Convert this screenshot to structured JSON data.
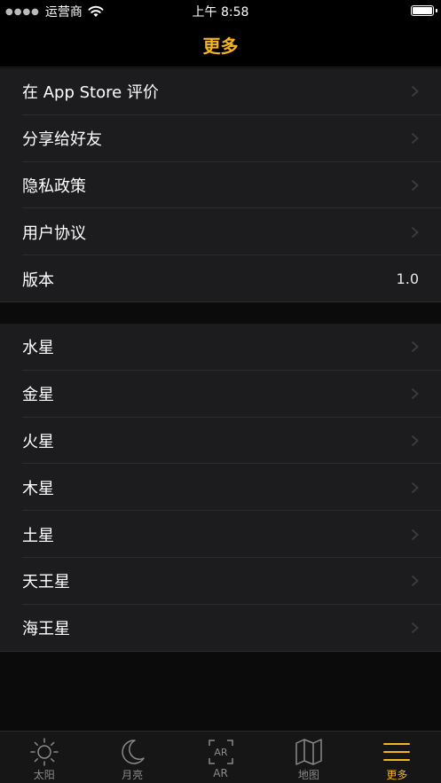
{
  "status_bar": {
    "carrier": "运营商",
    "time": "上午 8:58"
  },
  "nav": {
    "title": "更多"
  },
  "section_1": [
    {
      "label": "在 App Store 评价",
      "has_chevron": true
    },
    {
      "label": "分享给好友",
      "has_chevron": true
    },
    {
      "label": "隐私政策",
      "has_chevron": true
    },
    {
      "label": "用户协议",
      "has_chevron": true
    },
    {
      "label": "版本",
      "value": "1.0",
      "has_chevron": false
    }
  ],
  "section_2": [
    {
      "label": "水星"
    },
    {
      "label": "金星"
    },
    {
      "label": "火星"
    },
    {
      "label": "木星"
    },
    {
      "label": "土星"
    },
    {
      "label": "天王星"
    },
    {
      "label": "海王星"
    }
  ],
  "tabs": [
    {
      "label": "太阳",
      "icon": "sun-icon",
      "active": false
    },
    {
      "label": "月亮",
      "icon": "moon-icon",
      "active": false
    },
    {
      "label": "AR",
      "icon": "ar-icon",
      "active": false
    },
    {
      "label": "地图",
      "icon": "map-icon",
      "active": false
    },
    {
      "label": "更多",
      "icon": "menu-icon",
      "active": true
    }
  ],
  "colors": {
    "accent": "#f5b41d",
    "background": "#0b0b0b",
    "cell": "#1c1c1e",
    "inactive_tab": "#8a8a8a"
  }
}
